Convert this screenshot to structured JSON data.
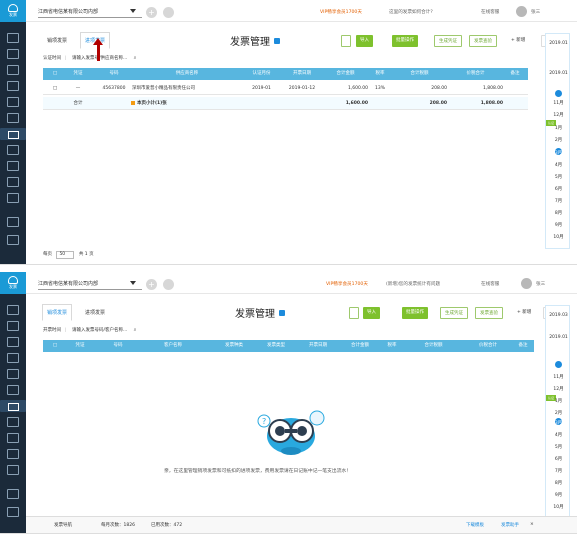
{
  "screen1": {
    "company": "江西省电信某有限公司内部",
    "add_icon": "+",
    "top": {
      "vip": "VIP畅享会员1700天",
      "question": "这里的发票如何合计?",
      "online": "在线客服",
      "user": "张三"
    },
    "tabs": [
      "销项发票",
      "进项发票"
    ],
    "page_title": "发票管理",
    "toolbar": [
      "导入",
      "批量操作",
      "生成凭证",
      "发票查验",
      "+ 新增",
      "更新"
    ],
    "filter": {
      "cert": "认证时间",
      "search_placeholder": "请输入发票号/供应商名称..."
    },
    "headers": [
      "凭证",
      "号码",
      "供应商名称",
      "认证月份",
      "开票日期",
      "合计金额",
      "税率",
      "合计税额",
      "价税合计",
      "备注"
    ],
    "rows": [
      {
        "voucher": "—",
        "number": "45637800",
        "vendor": "深圳市爱普小精品有限责任公司",
        "month": "2019-01",
        "date": "2019-01-12",
        "amount": "1,600.00",
        "rate": "13%",
        "tax": "208.00",
        "total": "1,808.00",
        "note": ""
      }
    ],
    "subtotal": {
      "label": "本页小计(1)张",
      "total_label": "合计",
      "amount": "1,600.00",
      "tax": "208.00",
      "total": "1,808.00"
    },
    "footer": {
      "per_page": "每页",
      "page_size": "50",
      "pages": "共 1 页"
    },
    "years": [
      "2019.01",
      "2019.01"
    ],
    "months": [
      "12月",
      "11月",
      "10月",
      "9月",
      "8月",
      "7月",
      "6月",
      "5月",
      "4月",
      "3月",
      "2月",
      "1月"
    ],
    "month_tag": "认证"
  },
  "screen2": {
    "company": "江西省电信某有限公司内部",
    "add_icon": "+",
    "top": {
      "vip": "VIP畅享会员1700天",
      "question": "(新增)您的发票统计有问题",
      "online": "在线客服",
      "user": "张三"
    },
    "tabs": [
      "销项发票",
      "进项发票"
    ],
    "page_title": "发票管理",
    "toolbar": [
      "导入",
      "批量操作",
      "生成凭证",
      "发票查验",
      "+ 新增",
      "更新"
    ],
    "filter": {
      "cert": "开票时间",
      "search_placeholder": "请输入发票号码/客户名称..."
    },
    "headers": [
      "凭证",
      "号码",
      "客户名称",
      "发票种类",
      "发票类型",
      "开票日期",
      "合计金额",
      "税率",
      "合计税额",
      "价税合计",
      "备注"
    ],
    "empty_message": "亲，在这里管理销项发票和可抵扣的进项发票，费用发票请在日记账中记一笔支出流水！",
    "years": [
      "2019.03",
      "2019.01"
    ],
    "months": [
      "11月",
      "12月",
      "1月",
      "2月",
      "3月",
      "4月",
      "5月",
      "6月",
      "7月",
      "8月",
      "9月",
      "10月"
    ],
    "month_tag": "认证",
    "bottom": {
      "entry": "发票导航",
      "count1": "每月次数：1826",
      "count2": "已用次数：472",
      "link1": "下载模板",
      "link2": "发票助手"
    }
  },
  "icons": [
    "shield-icon",
    "search-icon",
    "user-icon",
    "plus-icon",
    "arrow-icon"
  ]
}
